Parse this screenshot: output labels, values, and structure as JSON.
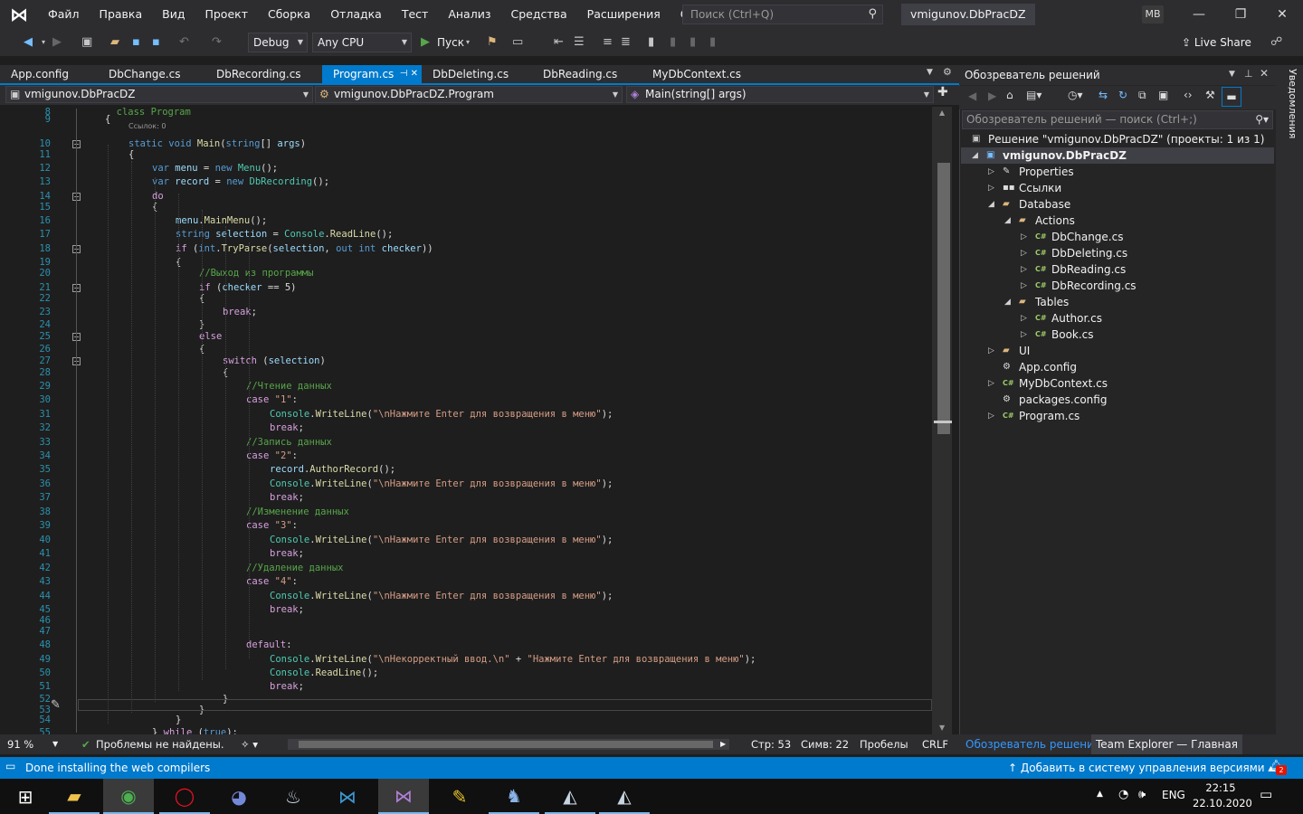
{
  "titlebar": {
    "menu": [
      "Файл",
      "Правка",
      "Вид",
      "Проект",
      "Сборка",
      "Отладка",
      "Тест",
      "Анализ",
      "Средства",
      "Расширения",
      "Окно",
      "Справка"
    ],
    "search_placeholder": "Поиск (Ctrl+Q)",
    "solution_name": "vmigunov.DbPracDZ",
    "user_initials": "MB"
  },
  "toolbar": {
    "config": "Debug",
    "platform": "Any CPU",
    "run_label": "Пуск",
    "live_share": "Live Share"
  },
  "tabs": [
    {
      "label": "App.config"
    },
    {
      "label": "DbChange.cs"
    },
    {
      "label": "DbRecording.cs"
    },
    {
      "label": "Program.cs",
      "active": true
    },
    {
      "label": "DbDeleting.cs"
    },
    {
      "label": "DbReading.cs"
    },
    {
      "label": "MyDbContext.cs"
    }
  ],
  "navbar": {
    "project": "vmigunov.DbPracDZ",
    "type": "vmigunov.DbPracDZ.Program",
    "member": "Main(string[] args)"
  },
  "editor": {
    "ref_hint": "Ссылок: 0",
    "lines": [
      {
        "n": "9",
        "t": "{"
      },
      {
        "n": "10",
        "t": "static void Main(string[] args)"
      },
      {
        "n": "11",
        "t": "{"
      },
      {
        "n": "12",
        "t": "var menu = new Menu();"
      },
      {
        "n": "13",
        "t": "var record = new DbRecording();"
      },
      {
        "n": "14",
        "t": "do"
      },
      {
        "n": "15",
        "t": "{"
      },
      {
        "n": "16",
        "t": "menu.MainMenu();"
      },
      {
        "n": "17",
        "t": "string selection = Console.ReadLine();"
      },
      {
        "n": "18",
        "t": "if (int.TryParse(selection, out int checker))"
      },
      {
        "n": "19",
        "t": "{"
      },
      {
        "n": "20",
        "t": "//Выход из программы"
      },
      {
        "n": "21",
        "t": "if (checker == 5)"
      },
      {
        "n": "22",
        "t": "{"
      },
      {
        "n": "23",
        "t": "break;"
      },
      {
        "n": "24",
        "t": "}"
      },
      {
        "n": "25",
        "t": "else"
      },
      {
        "n": "26",
        "t": "{"
      },
      {
        "n": "27",
        "t": "switch (selection)"
      },
      {
        "n": "28",
        "t": "{"
      },
      {
        "n": "29",
        "t": "//Чтение данных"
      },
      {
        "n": "30",
        "t": "case \"1\":"
      },
      {
        "n": "31",
        "t": "Console.WriteLine(\"\\nНажмите Enter для возвращения в меню\");"
      },
      {
        "n": "32",
        "t": "break;"
      },
      {
        "n": "33",
        "t": "//Запись данных"
      },
      {
        "n": "34",
        "t": "case \"2\":"
      },
      {
        "n": "35",
        "t": "record.AuthorRecord();"
      },
      {
        "n": "36",
        "t": "Console.WriteLine(\"\\nНажмите Enter для возвращения в меню\");"
      },
      {
        "n": "37",
        "t": "break;"
      },
      {
        "n": "38",
        "t": "//Изменение данных"
      },
      {
        "n": "39",
        "t": "case \"3\":"
      },
      {
        "n": "40",
        "t": "Console.WriteLine(\"\\nНажмите Enter для возвращения в меню\");"
      },
      {
        "n": "41",
        "t": "break;"
      },
      {
        "n": "42",
        "t": "//Удаление данных"
      },
      {
        "n": "43",
        "t": "case \"4\":"
      },
      {
        "n": "44",
        "t": "Console.WriteLine(\"\\nНажмите Enter для возвращения в меню\");"
      },
      {
        "n": "45",
        "t": "break;"
      },
      {
        "n": "46",
        "t": ""
      },
      {
        "n": "47",
        "t": ""
      },
      {
        "n": "48",
        "t": "default:"
      },
      {
        "n": "49",
        "t": "Console.WriteLine(\"\\nНекорректный ввод.\\n\" + \"Нажмите Enter для возвращения в меню\");"
      },
      {
        "n": "50",
        "t": "Console.ReadLine();"
      },
      {
        "n": "51",
        "t": "break;"
      },
      {
        "n": "52",
        "t": "}"
      },
      {
        "n": "53",
        "t": "}"
      },
      {
        "n": "54",
        "t": "}"
      },
      {
        "n": "55",
        "t": "} while (true);"
      }
    ]
  },
  "status_editor": {
    "zoom": "91 %",
    "problems": "Проблемы не найдены.",
    "line": "Стр: 53",
    "col": "Симв: 22",
    "spaces": "Пробелы",
    "eol": "CRLF"
  },
  "solution_explorer": {
    "title": "Обозреватель решений",
    "search_placeholder": "Обозреватель решений — поиск (Ctrl+;)",
    "tree": [
      {
        "label": "Решение \"vmigunov.DbPracDZ\" (проекты: 1 из 1)",
        "level": 0,
        "icon": "solution-icon"
      },
      {
        "label": "vmigunov.DbPracDZ",
        "level": 0,
        "icon": "csproj-icon",
        "bold": true,
        "expanded": true
      },
      {
        "label": "Properties",
        "level": 1,
        "icon": "wrench-icon",
        "collapsed": true
      },
      {
        "label": "Ссылки",
        "level": 1,
        "icon": "references-icon",
        "collapsed": true
      },
      {
        "label": "Database",
        "level": 1,
        "icon": "folder-icon",
        "expanded": true
      },
      {
        "label": "Actions",
        "level": 2,
        "icon": "folder-icon",
        "expanded": true
      },
      {
        "label": "DbChange.cs",
        "level": 3,
        "icon": "cs-file-icon",
        "collapsed": true
      },
      {
        "label": "DbDeleting.cs",
        "level": 3,
        "icon": "cs-file-icon",
        "collapsed": true
      },
      {
        "label": "DbReading.cs",
        "level": 3,
        "icon": "cs-file-icon",
        "collapsed": true
      },
      {
        "label": "DbRecording.cs",
        "level": 3,
        "icon": "cs-file-icon",
        "collapsed": true
      },
      {
        "label": "Tables",
        "level": 2,
        "icon": "folder-icon",
        "expanded": true
      },
      {
        "label": "Author.cs",
        "level": 3,
        "icon": "cs-file-icon",
        "collapsed": true
      },
      {
        "label": "Book.cs",
        "level": 3,
        "icon": "cs-file-icon",
        "collapsed": true
      },
      {
        "label": "UI",
        "level": 1,
        "icon": "folder-icon",
        "collapsed": true
      },
      {
        "label": "App.config",
        "level": 1,
        "icon": "config-icon"
      },
      {
        "label": "MyDbContext.cs",
        "level": 1,
        "icon": "cs-file-icon",
        "collapsed": true
      },
      {
        "label": "packages.config",
        "level": 1,
        "icon": "config-icon"
      },
      {
        "label": "Program.cs",
        "level": 1,
        "icon": "cs-file-icon",
        "collapsed": true
      }
    ],
    "footer_tabs": [
      "Обозреватель решений",
      "Team Explorer — Главная"
    ]
  },
  "side_tab": "Уведомления",
  "statusbar": {
    "message": "Done installing the web compilers",
    "source_control": "Добавить в систему управления версиями",
    "notifications_count": "2"
  },
  "taskbar": {
    "lang": "ENG",
    "time": "22:15",
    "date": "22.10.2020"
  }
}
